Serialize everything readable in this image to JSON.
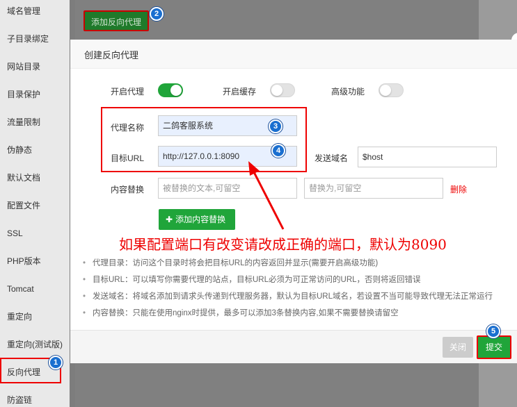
{
  "sidebar": {
    "items": [
      {
        "label": "域名管理"
      },
      {
        "label": "子目录绑定"
      },
      {
        "label": "网站目录"
      },
      {
        "label": "目录保护"
      },
      {
        "label": "流量限制"
      },
      {
        "label": "伪静态"
      },
      {
        "label": "默认文档"
      },
      {
        "label": "配置文件"
      },
      {
        "label": "SSL"
      },
      {
        "label": "PHP版本"
      },
      {
        "label": "Tomcat"
      },
      {
        "label": "重定向"
      },
      {
        "label": "重定向(测试版)"
      },
      {
        "label": "反向代理"
      },
      {
        "label": "防盗链"
      }
    ],
    "active_item": "反向代理"
  },
  "toolbar": {
    "add_proxy_label": "添加反向代理"
  },
  "modal": {
    "title": "创建反向代理",
    "toggles": {
      "enable_proxy": {
        "label": "开启代理",
        "on": true
      },
      "enable_cache": {
        "label": "开启缓存",
        "on": false
      },
      "advanced": {
        "label": "高级功能",
        "on": false
      }
    },
    "proxy_name": {
      "label": "代理名称",
      "value": "二鸽客服系统"
    },
    "target_url": {
      "label": "目标URL",
      "value": "http://127.0.0.1:8090"
    },
    "send_domain": {
      "label": "发送域名",
      "value": "$host"
    },
    "content_replace": {
      "label": "内容替换",
      "from_placeholder": "被替换的文本,可留空",
      "to_placeholder": "替换为,可留空",
      "delete_label": "删除"
    },
    "add_replace_label": "添加内容替换",
    "annotation": "如果配置端口有改变请改成正确的端口，默认为8090",
    "notes": [
      "代理目录：访问这个目录时将会把目标URL的内容返回并显示(需要开启高级功能)",
      "目标URL：可以填写你需要代理的站点，目标URL必须为可正常访问的URL，否则将返回错误",
      "发送域名：将域名添加到请求头传递到代理服务器，默认为目标URL域名，若设置不当可能导致代理无法正常运行",
      "内容替换：只能在使用nginx时提供，最多可以添加3条替换内容,如果不需要替换请留空"
    ],
    "close_label": "关闭",
    "submit_label": "提交"
  },
  "steps": {
    "s1": "1",
    "s2": "2",
    "s3": "3",
    "s4": "4",
    "s5": "5"
  },
  "colors": {
    "accent": "#20a53a",
    "annotation": "#e00000",
    "step_badge": "#1a6fd0"
  }
}
